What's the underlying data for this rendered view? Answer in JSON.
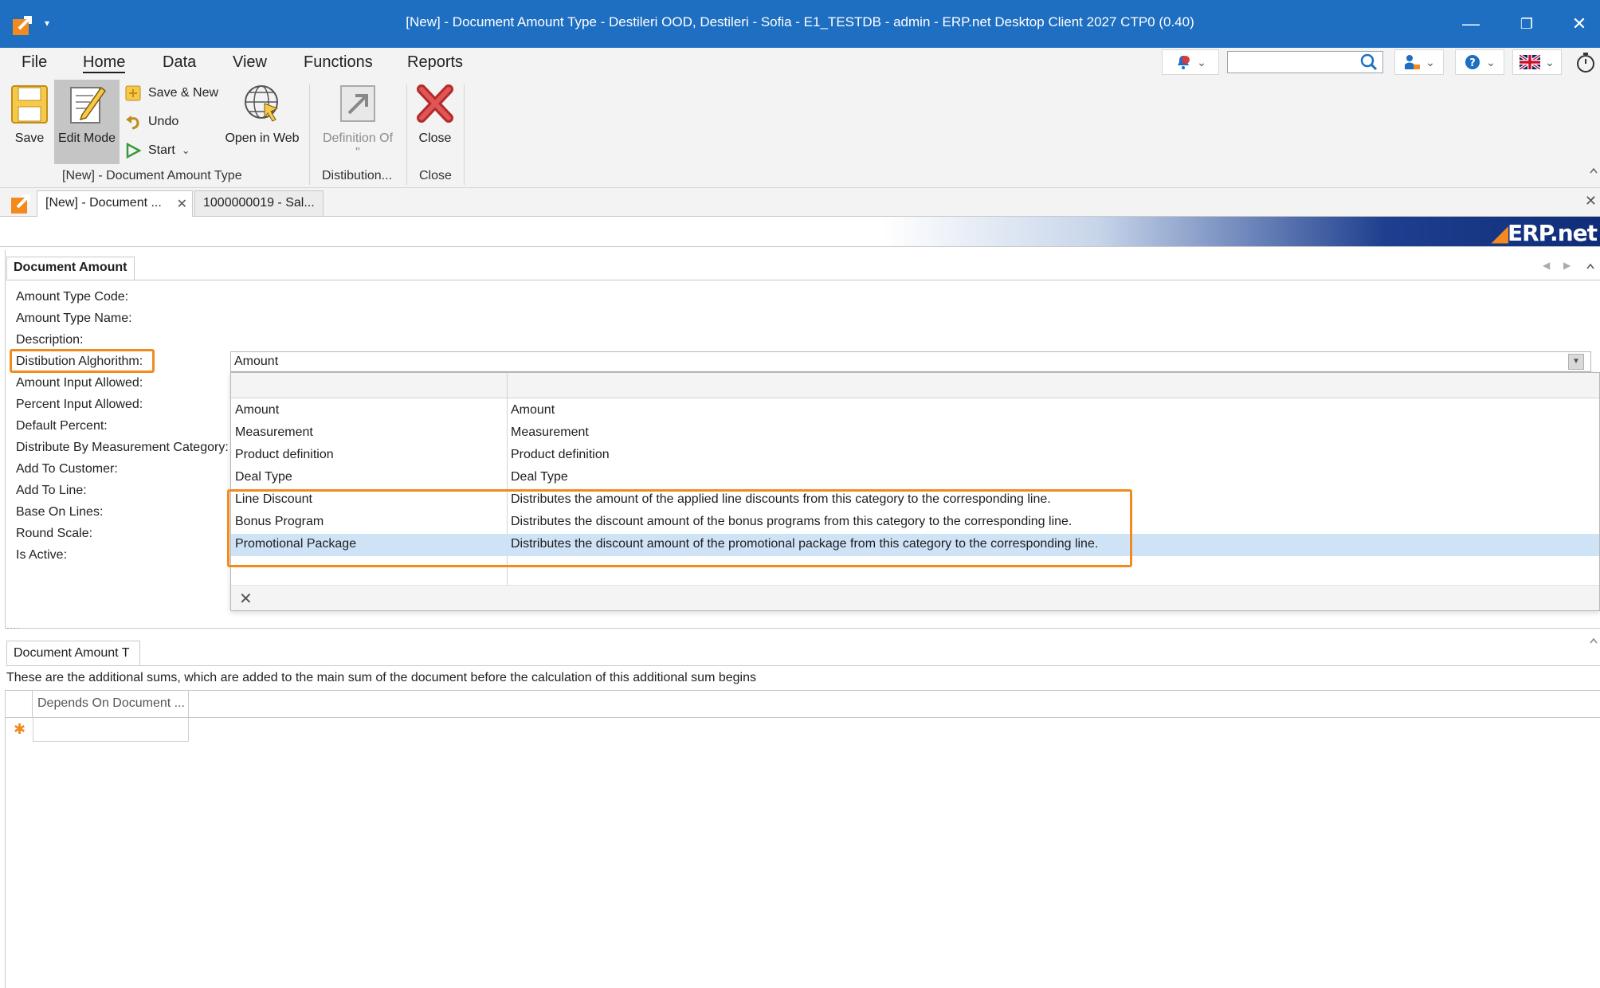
{
  "window": {
    "title": "[New] - Document Amount Type - Destileri OOD, Destileri - Sofia - E1_TESTDB - admin - ERP.net Desktop Client 2027 CTP0 (0.40)",
    "qa_dropdown": "▾",
    "minimize": "—",
    "restore": "❐",
    "close": "✕"
  },
  "menu": {
    "items": [
      "File",
      "Home",
      "Data",
      "View",
      "Functions",
      "Reports"
    ],
    "active": "Home"
  },
  "toolbar_right": {
    "notifications_icon": "bell-icon",
    "search_placeholder": "",
    "user_icon": "user-icon",
    "help_icon": "help-icon",
    "language_icon": "uk-flag-icon",
    "timer_icon": "stopwatch-icon",
    "chevron": "⌄"
  },
  "ribbon": {
    "save": "Save",
    "edit_mode": "Edit Mode",
    "save_new": "Save & New",
    "undo": "Undo",
    "start": "Start",
    "open_in_web": "Open in Web",
    "definition_of": "Definition Of \"",
    "close": "Close",
    "group_main": "[New] - Document Amount Type",
    "group_distribution": "Distibution...",
    "group_close": "Close"
  },
  "doc_tabs": [
    {
      "label": "[New] - Document ...",
      "active": true
    },
    {
      "label": "1000000019 - Sal...",
      "active": false
    }
  ],
  "banner": {
    "logo_text": "ERP.net"
  },
  "form": {
    "section_title": "Document Amount",
    "labels": [
      "Amount Type Code:",
      "Amount Type Name:",
      "Description:",
      "Distibution Alghorithm:",
      "Amount Input Allowed:",
      "Percent Input Allowed:",
      "Default Percent:",
      "Distribute By Measurement Category:",
      "Add To Customer:",
      "Add To Line:",
      "Base On Lines:",
      "Round Scale:",
      "Is Active:"
    ],
    "distribution_value": "Amount"
  },
  "dropdown": {
    "rows": [
      {
        "name": "Amount",
        "description": "Amount"
      },
      {
        "name": "Measurement",
        "description": "Measurement"
      },
      {
        "name": "Product definition",
        "description": "Product definition"
      },
      {
        "name": "Deal Type",
        "description": "Deal Type"
      },
      {
        "name": "Line Discount",
        "description": "Distributes the amount of the applied line discounts from this category to the corresponding line."
      },
      {
        "name": "Bonus Program",
        "description": "Distributes the discount amount of the bonus programs from this category to the corresponding line."
      },
      {
        "name": "Promotional Package",
        "description": "Distributes the discount amount of the promotional package from this category to the corresponding line."
      }
    ],
    "selected_index": 6,
    "clear": "✕"
  },
  "bottom": {
    "tab_label": "Document Amount T",
    "info": "These are the additional sums, which are added to the main sum of the document before the calculation of this additional sum begins",
    "grid_column": "Depends On Document ...",
    "new_row_marker": "✱"
  },
  "colors": {
    "titlebar": "#1e6ec2",
    "highlight": "#f28a1e",
    "selected_row": "#cfe3f7"
  }
}
